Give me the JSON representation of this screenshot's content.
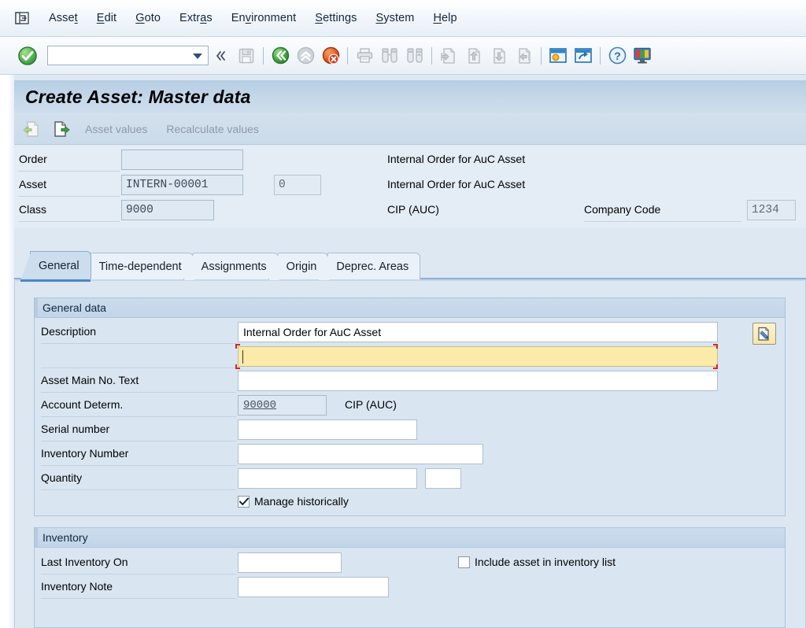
{
  "menubar": {
    "system_icon": "system-menu-icon",
    "items": [
      {
        "label": "Asset",
        "accel_index": 4
      },
      {
        "label": "Edit",
        "accel_index": 0
      },
      {
        "label": "Goto",
        "accel_index": 0
      },
      {
        "label": "Extras",
        "accel_index": 4
      },
      {
        "label": "Environment",
        "accel_index": 3
      },
      {
        "label": "Settings",
        "accel_index": 0
      },
      {
        "label": "System",
        "accel_index": 0
      },
      {
        "label": "Help",
        "accel_index": 0
      }
    ]
  },
  "toolbar": {
    "enter_icon": "enter-green-check-icon",
    "command_field": {
      "value": "",
      "placeholder": ""
    },
    "dropdown_icon": "chevron-down-icon",
    "collapse_icon": "double-chevron-left-icon",
    "buttons": [
      {
        "name": "save-button",
        "icon": "save-floppy-icon",
        "enabled": false
      },
      {
        "name": "back-button",
        "icon": "back-green-icon",
        "enabled": true
      },
      {
        "name": "exit-button",
        "icon": "exit-up-icon",
        "enabled": false
      },
      {
        "name": "cancel-button",
        "icon": "cancel-red-x-icon",
        "enabled": true
      },
      {
        "name": "print-button",
        "icon": "print-icon",
        "enabled": false
      },
      {
        "name": "find-button",
        "icon": "binoculars-find-icon",
        "enabled": false
      },
      {
        "name": "find-next-button",
        "icon": "binoculars-find-next-icon",
        "enabled": false
      },
      {
        "name": "first-page-button",
        "icon": "first-page-icon",
        "enabled": false
      },
      {
        "name": "previous-page-button",
        "icon": "previous-page-icon",
        "enabled": false
      },
      {
        "name": "next-page-button",
        "icon": "next-page-icon",
        "enabled": false
      },
      {
        "name": "last-page-button",
        "icon": "last-page-icon",
        "enabled": false
      },
      {
        "name": "new-session-button",
        "icon": "new-session-icon",
        "enabled": true
      },
      {
        "name": "create-shortcut-button",
        "icon": "create-shortcut-icon",
        "enabled": true
      },
      {
        "name": "help-button",
        "icon": "help-question-icon",
        "enabled": true
      },
      {
        "name": "customize-layout-button",
        "icon": "customize-layout-monitor-icon",
        "enabled": true
      }
    ]
  },
  "screen": {
    "title": "Create Asset:  Master data"
  },
  "apptoolbar": {
    "buttons": [
      {
        "name": "previous-asset-button",
        "icon": "document-left-arrow-icon",
        "enabled": false
      },
      {
        "name": "next-asset-button",
        "icon": "document-right-arrow-icon",
        "enabled": true
      }
    ],
    "asset_values_label": "Asset values",
    "recalculate_values_label": "Recalculate values"
  },
  "header": {
    "rows": [
      {
        "label": "Order",
        "value": "",
        "desc": "Internal Order for AuC Asset"
      },
      {
        "label": "Asset",
        "value": "INTERN-00001",
        "subnumber": "0",
        "desc": "Internal Order for AuC Asset"
      },
      {
        "label": "Class",
        "value": "9000",
        "desc": "CIP (AUC)"
      }
    ],
    "company_code_label": "Company Code",
    "company_code_value": "1234"
  },
  "tabs": [
    {
      "label": "General",
      "active": true
    },
    {
      "label": "Time-dependent",
      "active": false
    },
    {
      "label": "Assignments",
      "active": false
    },
    {
      "label": "Origin",
      "active": false
    },
    {
      "label": "Deprec. Areas",
      "active": false
    }
  ],
  "general_data": {
    "group_title": "General data",
    "description_label": "Description",
    "description_value": "Internal Order for AuC Asset",
    "description_line2_value": "",
    "long_text_button_icon": "edit-long-text-pencil-icon",
    "asset_main_no_text_label": "Asset Main No. Text",
    "asset_main_no_text_value": "",
    "account_determ_label": "Account Determ.",
    "account_determ_value": "90000",
    "account_determ_desc": "CIP (AUC)",
    "serial_number_label": "Serial number",
    "serial_number_value": "",
    "inventory_number_label": "Inventory Number",
    "inventory_number_value": "",
    "quantity_label": "Quantity",
    "quantity_value": "",
    "quantity_unit_value": "",
    "manage_historically_label": "Manage historically",
    "manage_historically_checked": true,
    "check-icon": "checkmark-icon"
  },
  "inventory": {
    "group_title": "Inventory",
    "last_inventory_on_label": "Last Inventory On",
    "last_inventory_on_value": "",
    "include_asset_label": "Include asset in inventory list",
    "include_asset_checked": false,
    "inventory_note_label": "Inventory Note",
    "inventory_note_value": ""
  },
  "colors": {
    "accent_blue": "#4a86c5",
    "focus_yellow": "#fbeaa8",
    "focus_marker_red": "#e02020",
    "panel_blue": "#dce7f2",
    "title_blue": "#c4d7e9"
  }
}
